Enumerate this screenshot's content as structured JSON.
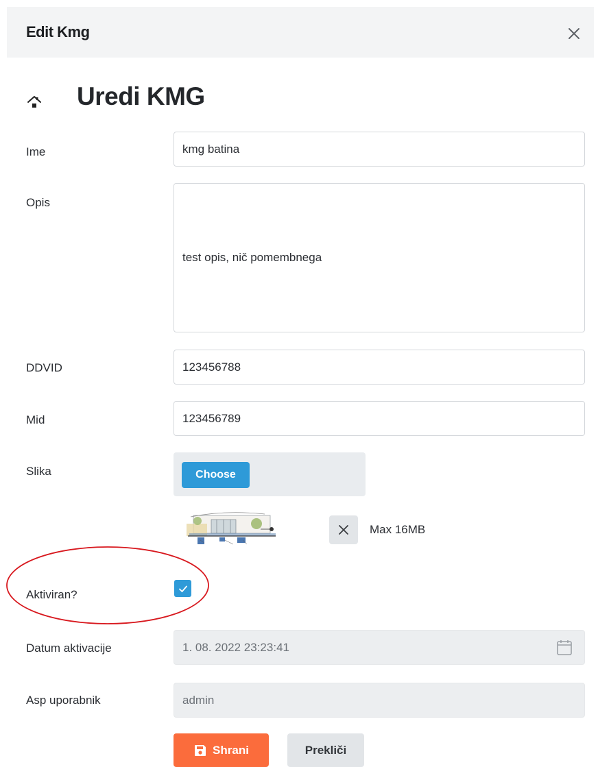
{
  "window": {
    "title": "Edit Kmg",
    "close_icon": "close-icon"
  },
  "page": {
    "heading": "Uredi KMG",
    "heading_icon": "home-icon"
  },
  "form": {
    "ime": {
      "label": "Ime",
      "value": "kmg batina"
    },
    "opis": {
      "label": "Opis",
      "value": "test opis, nič pomembnega"
    },
    "ddvid": {
      "label": "DDVID",
      "value": "123456788"
    },
    "mid": {
      "label": "Mid",
      "value": "123456789"
    },
    "slika": {
      "label": "Slika",
      "choose_label": "Choose",
      "max_size": "Max 16MB",
      "remove_icon": "close-icon"
    },
    "aktiviran": {
      "label": "Aktiviran?",
      "checked": true
    },
    "datum": {
      "label": "Datum aktivacije",
      "value": "1. 08. 2022 23:23:41",
      "icon": "calendar-icon"
    },
    "asp": {
      "label": "Asp uporabnik",
      "value": "admin"
    }
  },
  "actions": {
    "save_label": "Shrani",
    "save_icon": "save-icon",
    "cancel_label": "Prekliči"
  },
  "colors": {
    "primary": "#2e9ad8",
    "save": "#fb6c3c",
    "annotation": "#d8191f"
  }
}
